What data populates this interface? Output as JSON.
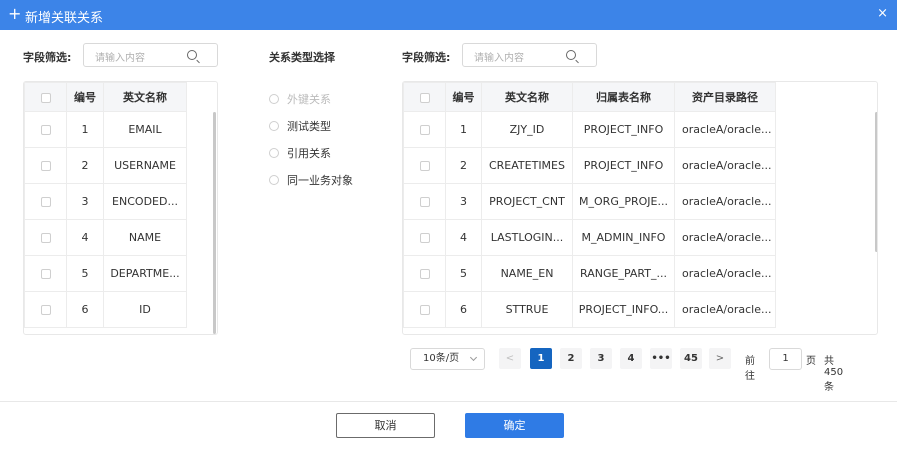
{
  "dialog": {
    "title": "新增关联关系",
    "close_glyph": "×",
    "plus_glyph": "+"
  },
  "left": {
    "filter_label": "字段筛选:",
    "search_placeholder": "请输入内容",
    "columns": [
      "编号",
      "英文名称"
    ],
    "rows": [
      {
        "no": "1",
        "name": "EMAIL"
      },
      {
        "no": "2",
        "name": "USERNAME"
      },
      {
        "no": "3",
        "name": "ENCODED..."
      },
      {
        "no": "4",
        "name": "NAME"
      },
      {
        "no": "5",
        "name": "DEPARTME..."
      },
      {
        "no": "6",
        "name": "ID"
      }
    ]
  },
  "middle": {
    "label": "关系类型选择",
    "options": [
      {
        "label": "外键关系",
        "disabled": true
      },
      {
        "label": "测试类型",
        "disabled": false
      },
      {
        "label": "引用关系",
        "disabled": false
      },
      {
        "label": "同一业务对象",
        "disabled": false
      }
    ]
  },
  "right": {
    "filter_label": "字段筛选:",
    "search_placeholder": "请输入内容",
    "columns": [
      "编号",
      "英文名称",
      "归属表名称",
      "资产目录路径"
    ],
    "rows": [
      {
        "no": "1",
        "name": "ZJY_ID",
        "table": "PROJECT_INFO",
        "path": "oracleA/oracle..."
      },
      {
        "no": "2",
        "name": "CREATETIMES",
        "table": "PROJECT_INFO",
        "path": "oracleA/oracle..."
      },
      {
        "no": "3",
        "name": "PROJECT_CNT",
        "table": "M_ORG_PROJE...",
        "path": "oracleA/oracle..."
      },
      {
        "no": "4",
        "name": "LASTLOGIN...",
        "table": "M_ADMIN_INFO",
        "path": "oracleA/oracle..."
      },
      {
        "no": "5",
        "name": "NAME_EN",
        "table": "RANGE_PART_...",
        "path": "oracleA/oracle..."
      },
      {
        "no": "6",
        "name": "STTRUE",
        "table": "PROJECT_INFO...",
        "path": "oracleA/oracle..."
      }
    ]
  },
  "pagination": {
    "page_size": "10条/页",
    "prev": "<",
    "next": ">",
    "pages": [
      "1",
      "2",
      "3",
      "4",
      "•••",
      "45"
    ],
    "current_page": "1",
    "goto_prefix": "前往",
    "goto_value": "1",
    "goto_suffix": "页",
    "total": "共 450 条"
  },
  "buttons": {
    "cancel": "取消",
    "confirm": "确定"
  },
  "colors": {
    "header": "#3c84e8",
    "primary": "#2f7be5",
    "active_page": "#1565c0"
  }
}
